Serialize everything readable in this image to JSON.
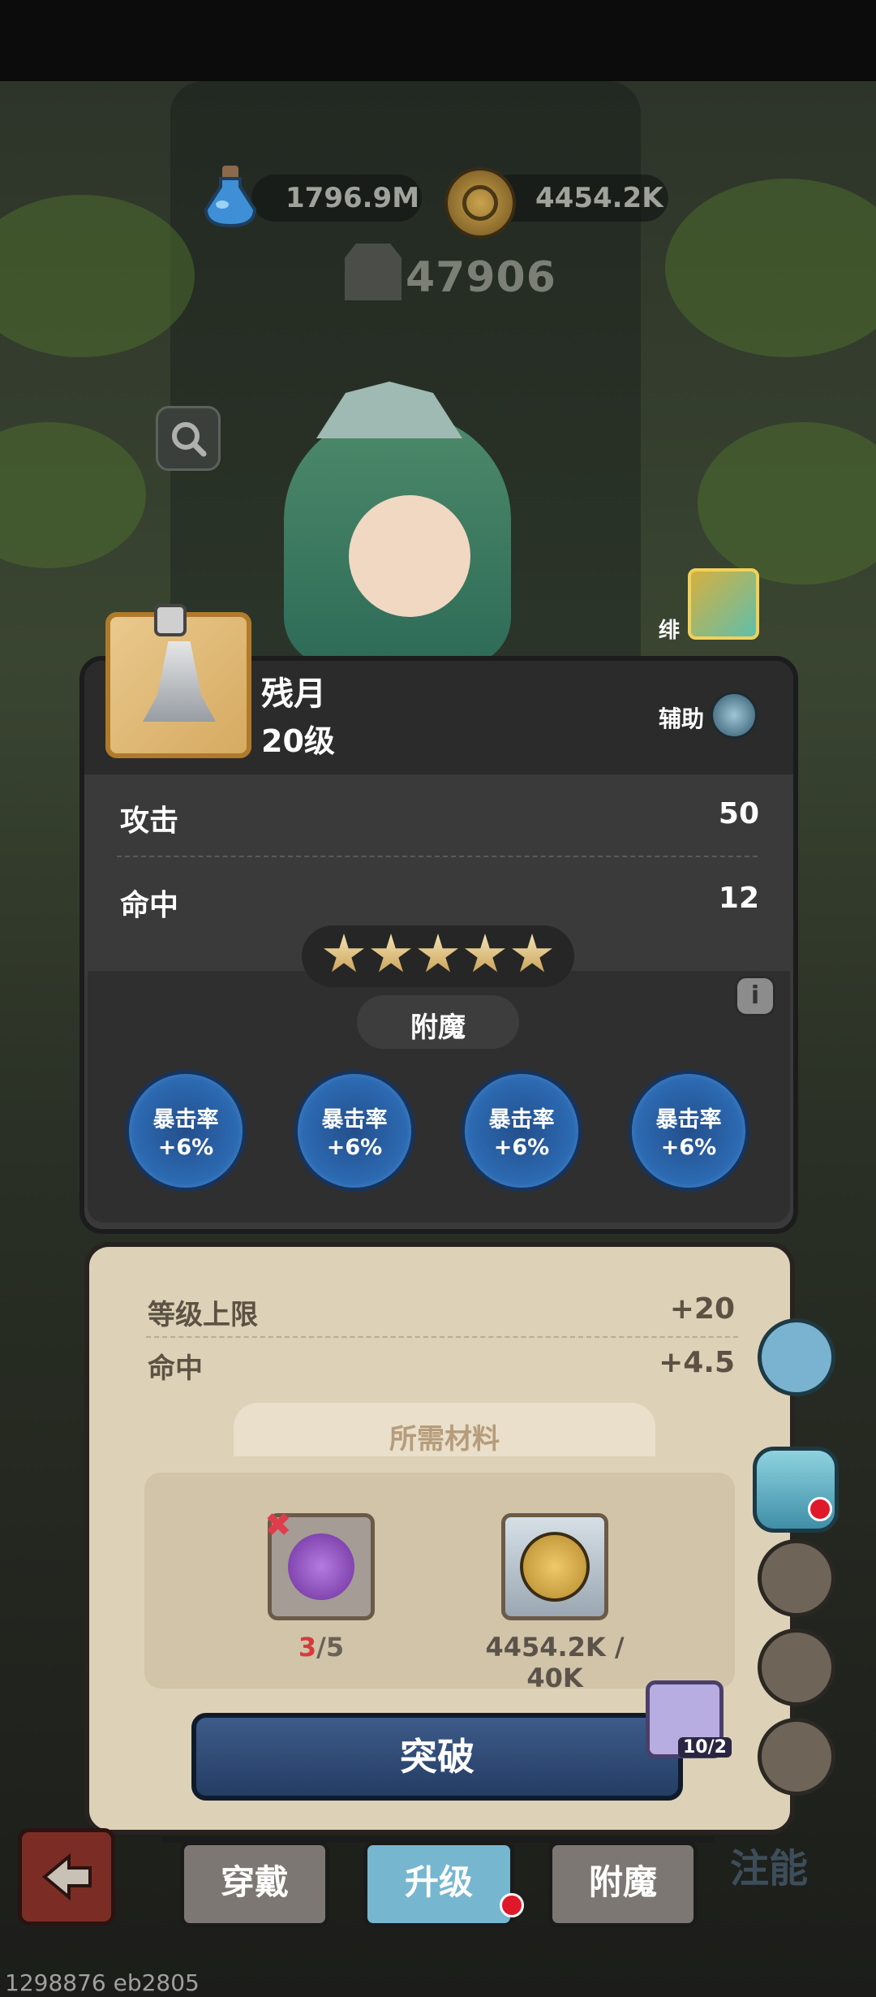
{
  "currency": {
    "potion_amount": "1796.9M",
    "coin_amount": "4454.2K"
  },
  "power": "47906",
  "hero": {
    "portrait_label": "绯"
  },
  "item": {
    "name": "残月",
    "level": "20级",
    "role": "辅助"
  },
  "stats": [
    {
      "name": "攻击",
      "value": "50"
    },
    {
      "name": "命中",
      "value": "12"
    }
  ],
  "stars": 5,
  "enchant": {
    "title": "附魔",
    "info": "i",
    "runes": [
      {
        "name": "暴击率",
        "value": "+6%"
      },
      {
        "name": "暴击率",
        "value": "+6%"
      },
      {
        "name": "暴击率",
        "value": "+6%"
      },
      {
        "name": "暴击率",
        "value": "+6%"
      }
    ]
  },
  "upgrade": {
    "rows": [
      {
        "name": "等级上限",
        "value": "+20"
      },
      {
        "name": "命中",
        "value": "+4.5"
      }
    ],
    "materials_title": "所需材料",
    "material1": {
      "have": "3",
      "need": "/5",
      "missing_mark": "✖"
    },
    "material2": {
      "count": "4454.2K / 40K"
    },
    "break_label": "突破",
    "badge_count": "10/2"
  },
  "tabs": {
    "wear": "穿戴",
    "upgrade": "升级",
    "enchant": "附魔"
  },
  "ghost_label": "注能",
  "build_id": "1298876 eb2805"
}
